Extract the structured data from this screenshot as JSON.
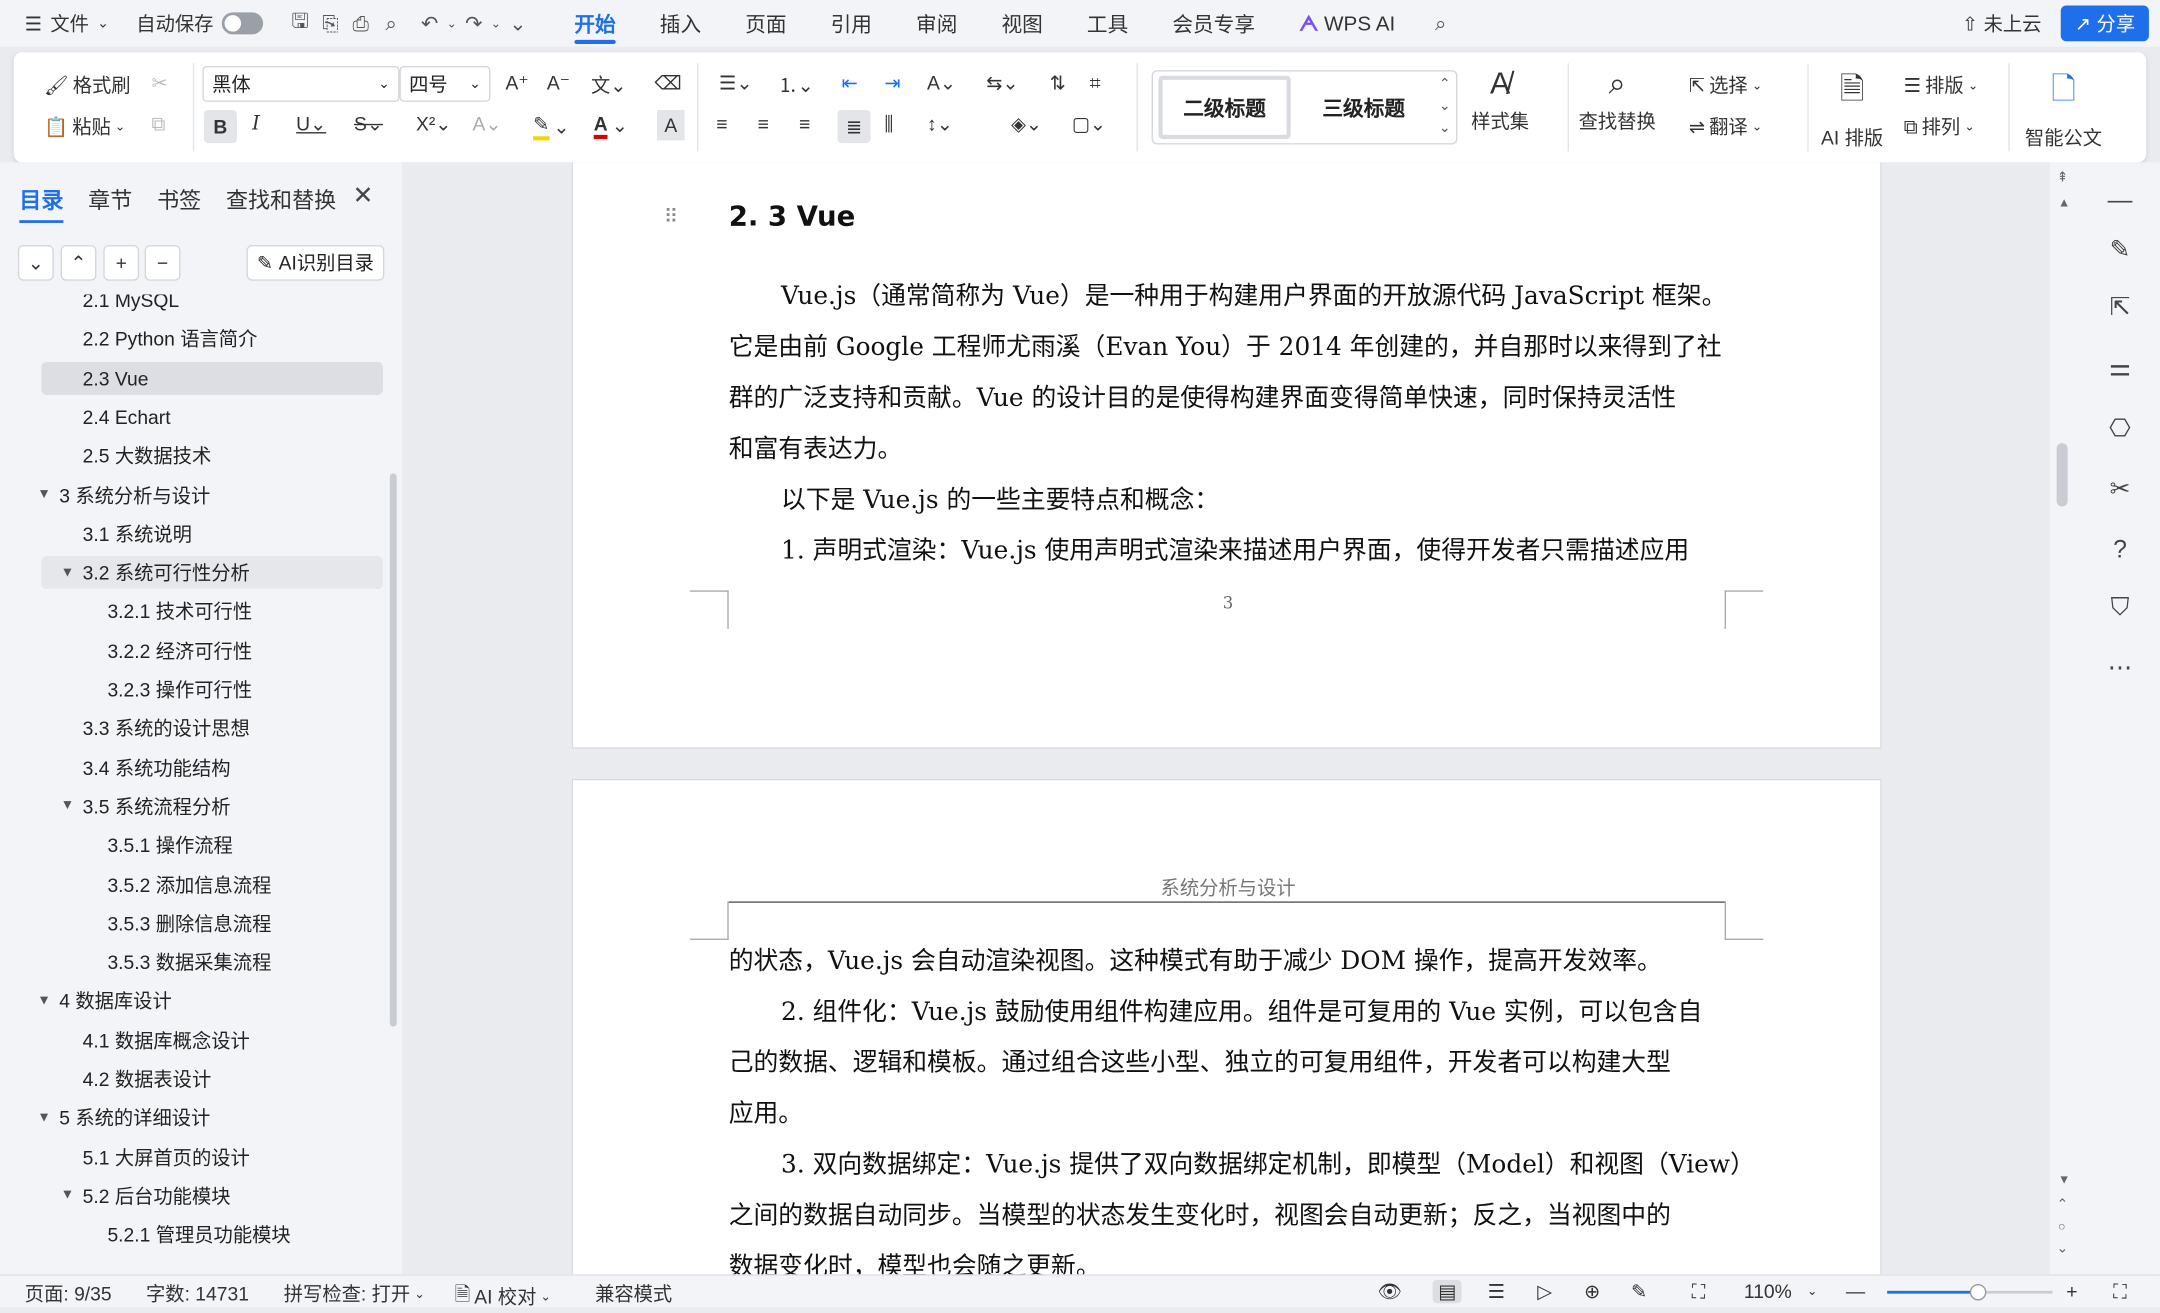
{
  "topbar": {
    "menu_label": "文件",
    "autosave_label": "自动保存",
    "tabs": [
      "开始",
      "插入",
      "页面",
      "引用",
      "审阅",
      "视图",
      "工具",
      "会员专享",
      "WPS AI"
    ],
    "active_tab": "开始",
    "cloud_label": "未上云",
    "share_label": "分享"
  },
  "ribbon": {
    "format_painter": "格式刷",
    "paste": "粘贴",
    "font_name": "黑体",
    "font_size": "四号",
    "style_h2": "二级标题",
    "style_h3": "三级标题",
    "style_set": "样式集",
    "find_replace": "查找替换",
    "select": "选择",
    "translate": "翻译",
    "ai_layout": "AI 排版",
    "layout": "排版",
    "arrange": "排列",
    "smart_doc": "智能公文"
  },
  "sidebar": {
    "tabs": [
      "目录",
      "章节",
      "书签",
      "查找和替换"
    ],
    "active_tab": "目录",
    "ai_toc_label": "AI识别目录",
    "toc": [
      {
        "label": "2.1 MySQL",
        "level": 2,
        "state": "partial"
      },
      {
        "label": "2.2 Python 语言简介",
        "level": 2
      },
      {
        "label": "2.3 Vue",
        "level": 2,
        "selected": true
      },
      {
        "label": "2.4 Echart",
        "level": 2
      },
      {
        "label": "2.5  大数据技术",
        "level": 2
      },
      {
        "label": "3 系统分析与设计",
        "level": 1,
        "expanded": true
      },
      {
        "label": "3.1 系统说明",
        "level": 2
      },
      {
        "label": "3.2 系统可行性分析",
        "level": 2,
        "expanded": true,
        "hover": true
      },
      {
        "label": "3.2.1 技术可行性",
        "level": 3
      },
      {
        "label": "3.2.2 经济可行性",
        "level": 3
      },
      {
        "label": "3.2.3 操作可行性",
        "level": 3
      },
      {
        "label": "3.3 系统的设计思想",
        "level": 2
      },
      {
        "label": "3.4 系统功能结构",
        "level": 2
      },
      {
        "label": "3.5 系统流程分析",
        "level": 2,
        "expanded": true
      },
      {
        "label": "3.5.1 操作流程",
        "level": 3
      },
      {
        "label": "3.5.2 添加信息流程",
        "level": 3
      },
      {
        "label": "3.5.3 删除信息流程",
        "level": 3
      },
      {
        "label": "3.5.3    数据采集流程",
        "level": 3
      },
      {
        "label": "4 数据库设计",
        "level": 1,
        "expanded": true
      },
      {
        "label": "4.1 数据库概念设计",
        "level": 2
      },
      {
        "label": "4.2 数据表设计",
        "level": 2
      },
      {
        "label": "5 系统的详细设计",
        "level": 1,
        "expanded": true
      },
      {
        "label": "5.1 大屏首页的设计",
        "level": 2
      },
      {
        "label": "5.2 后台功能模块",
        "level": 2,
        "expanded": true
      },
      {
        "label": "5.2.1 管理员功能模块",
        "level": 3
      }
    ]
  },
  "document": {
    "page1": {
      "heading": "2. 3  Vue",
      "lines": [
        "Vue.js（通常简称为 Vue）是一种用于构建用户界面的开放源代码 JavaScript 框架。",
        "它是由前 Google 工程师尤雨溪（Evan You）于 2014 年创建的，并自那时以来得到了社",
        "群的广泛支持和贡献。Vue 的设计目的是使得构建界面变得简单快速，同时保持灵活性",
        "和富有表达力。",
        "以下是 Vue.js 的一些主要特点和概念：",
        "1.  声明式渲染：Vue.js 使用声明式渲染来描述用户界面，使得开发者只需描述应用"
      ],
      "page_number": "3"
    },
    "page2": {
      "header": "系统分析与设计",
      "lines": [
        "的状态，Vue.js 会自动渲染视图。这种模式有助于减少 DOM 操作，提高开发效率。",
        "2.  组件化：Vue.js 鼓励使用组件构建应用。组件是可复用的 Vue 实例，可以包含自",
        "己的数据、逻辑和模板。通过组合这些小型、独立的可复用组件，开发者可以构建大型",
        "应用。",
        "3.  双向数据绑定：Vue.js 提供了双向数据绑定机制，即模型（Model）和视图（View）",
        "之间的数据自动同步。当模型的状态发生变化时，视图会自动更新；反之，当视图中的",
        "数据变化时，模型也会随之更新。"
      ]
    }
  },
  "status": {
    "page": "页面: 9/35",
    "words": "字数: 14731",
    "spell": "拼写检查: 打开",
    "ai_check": "AI 校对",
    "compat": "兼容模式",
    "zoom": "110%",
    "zoom_level": 0.55
  }
}
